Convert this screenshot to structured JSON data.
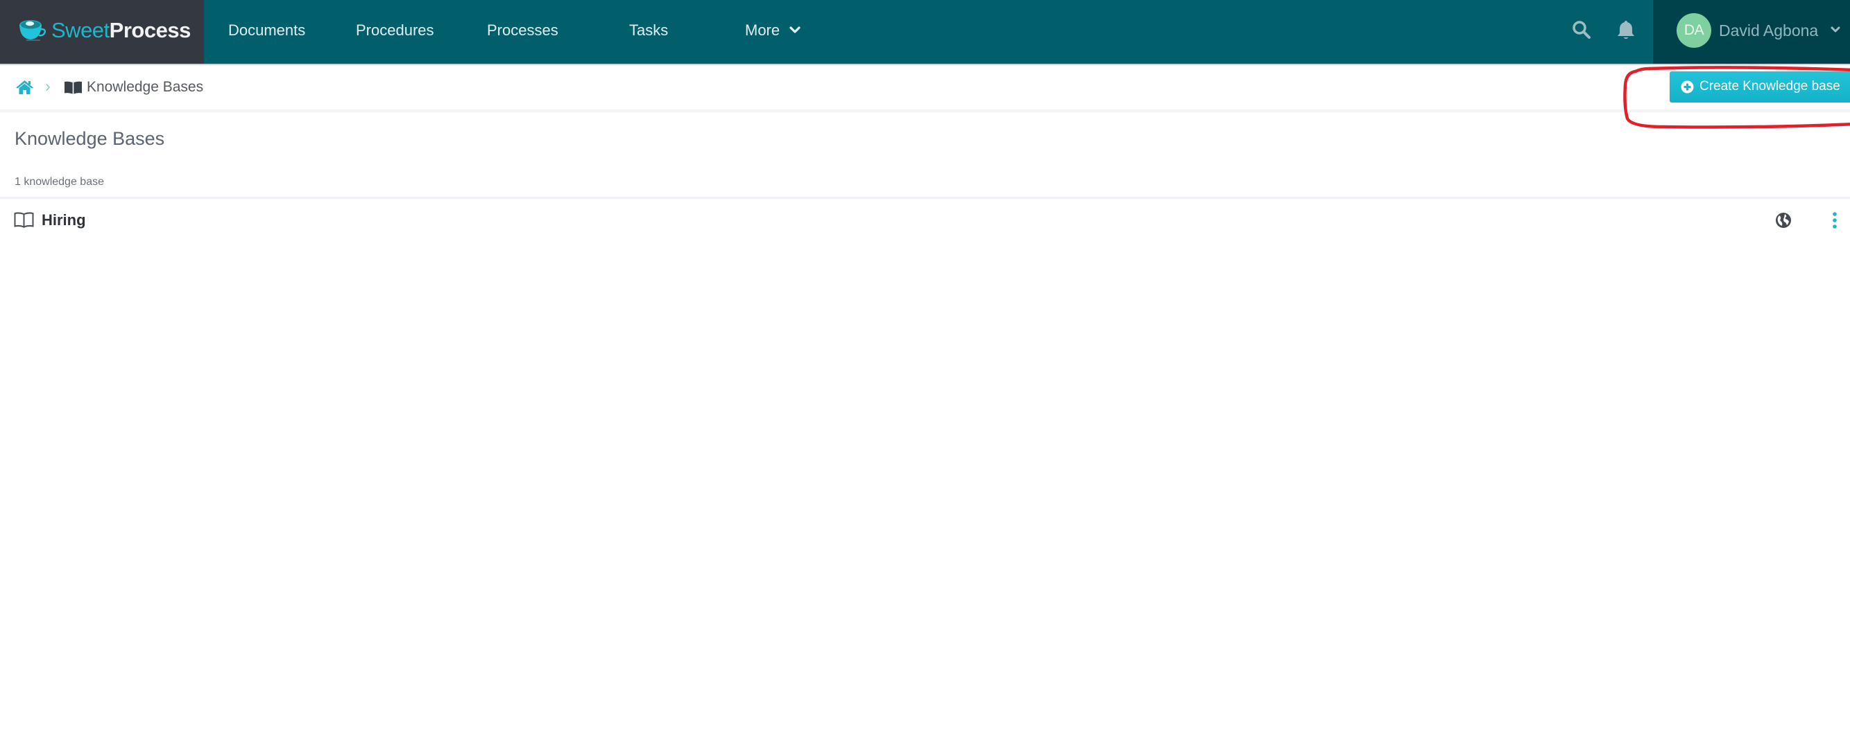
{
  "app": {
    "brand_part1": "Sweet",
    "brand_part2": "Process"
  },
  "nav": {
    "items": [
      {
        "label": "Documents"
      },
      {
        "label": "Procedures"
      },
      {
        "label": "Processes"
      },
      {
        "label": "Tasks"
      },
      {
        "label": "More"
      }
    ],
    "search_icon": "search-icon",
    "notifications_icon": "bell-icon",
    "user": {
      "initials": "DA",
      "name": "David Agbona"
    }
  },
  "breadcrumb": {
    "home_icon": "home-icon",
    "current_icon": "book-icon",
    "current_label": "Knowledge Bases"
  },
  "actions": {
    "create_label": "Create Knowledge base",
    "create_icon": "plus-circle-icon"
  },
  "page": {
    "title": "Knowledge Bases",
    "count_label": "1 knowledge base"
  },
  "knowledge_bases": [
    {
      "name": "Hiring",
      "visibility_icon": "globe-icon"
    }
  ],
  "colors": {
    "nav_bg": "#005f6b",
    "logo_bg": "#343840",
    "user_bg": "#00424c",
    "accent": "#17b8d0",
    "avatar_bg": "#7fd0a0",
    "highlight": "#e0202a"
  }
}
